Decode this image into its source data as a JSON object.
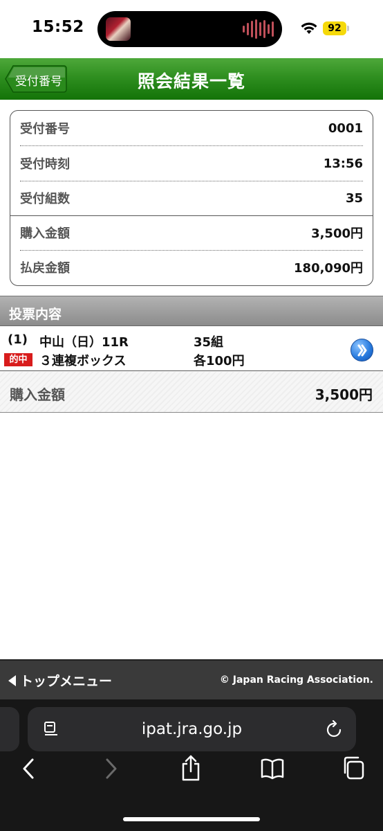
{
  "status_bar": {
    "time": "15:52",
    "battery": "92"
  },
  "header": {
    "back_label": "受付番号",
    "title": "照会結果一覧"
  },
  "summary": {
    "rows": [
      {
        "label": "受付番号",
        "value": "0001"
      },
      {
        "label": "受付時刻",
        "value": "13:56"
      },
      {
        "label": "受付組数",
        "value": "35"
      },
      {
        "label": "購入金額",
        "value": "3,500円"
      },
      {
        "label": "払戻金額",
        "value": "180,090円"
      }
    ]
  },
  "bet_section": {
    "title": "投票内容",
    "bet": {
      "number": "(1)",
      "race": "中山（日）11R",
      "combos": "35組",
      "hit_badge": "的中",
      "bet_type": "３連複ボックス",
      "unit_amount": "各100円"
    },
    "total_label": "購入金額",
    "total_value": "3,500円"
  },
  "footer": {
    "menu_label": "トップメニュー",
    "copyright": "© Japan Racing Association."
  },
  "browser": {
    "url": "ipat.jra.go.jp"
  },
  "colors": {
    "header_green": "#2f8f20",
    "hit_red": "#d81c1c",
    "battery_yellow": "#f5d90a",
    "footer_gray": "#3a3a3a"
  },
  "icons": [
    "wifi-icon",
    "back-arrow-icon",
    "chevron-right-icon",
    "page-menu-icon",
    "reload-icon",
    "back-icon",
    "forward-icon",
    "share-icon",
    "bookmarks-icon",
    "tabs-icon"
  ]
}
